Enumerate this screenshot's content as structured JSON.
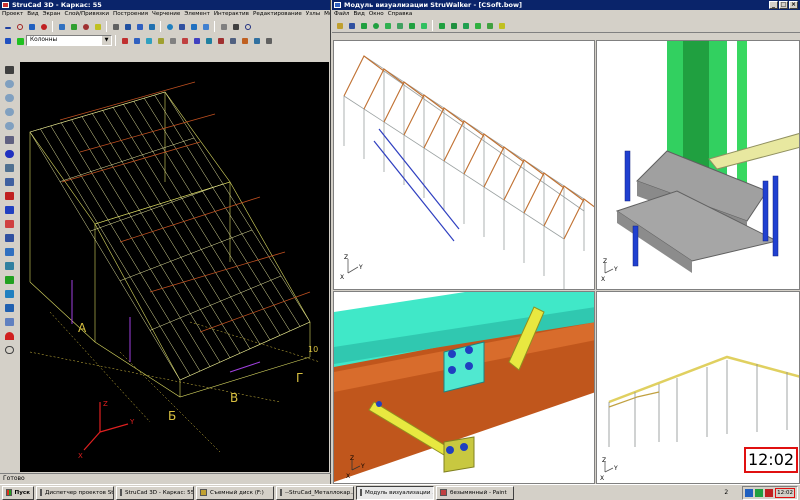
{
  "left_window": {
    "title": "StruCad 3D - Каркас: 55",
    "menu": [
      "Проект",
      "Вид",
      "Экран",
      "Слой/Привязки",
      "Построения",
      "Черчение",
      "Элемент",
      "Интерактив",
      "Редактирование",
      "Узлы",
      "Модель/Обмен"
    ],
    "layer_select": "Колонны",
    "status_text": "Готово",
    "axis_labels": {
      "x": "X",
      "y": "Y",
      "z": "Z"
    },
    "grid_letters": [
      "А",
      "Б",
      "В",
      "Г"
    ],
    "grid_number": "10",
    "viewport_bg": "#000000"
  },
  "right_window": {
    "title": "Модуль визуализации StruWalker - [CSoft.bow]",
    "menu": [
      "Файл",
      "Вид",
      "Окно",
      "Справка"
    ],
    "axis_labels": {
      "x": "X",
      "y": "Y",
      "z": "Z"
    },
    "viewport_bg": "#ffffff"
  },
  "taskbar": {
    "start_label": "Пуск",
    "tasks": [
      "Диспетчер проектов St...",
      "StruCad 3D - Каркас: 55",
      "Съемный диск (F:)",
      "--StruCad_Металлокар...",
      "Модуль визуализации ...",
      "безымянный - Paint"
    ],
    "tray_number": "2",
    "clock": "12:02",
    "clock_zoom": "12:02"
  },
  "colors": {
    "title_active": "#0a246a",
    "title_inactive": "#7a96df",
    "highlight_red": "#e01010",
    "teal": "#3ad0b8",
    "rust": "#b8501a",
    "yellow": "#e8e850",
    "plate": "#909090",
    "blue_bolt": "#2040d0"
  }
}
